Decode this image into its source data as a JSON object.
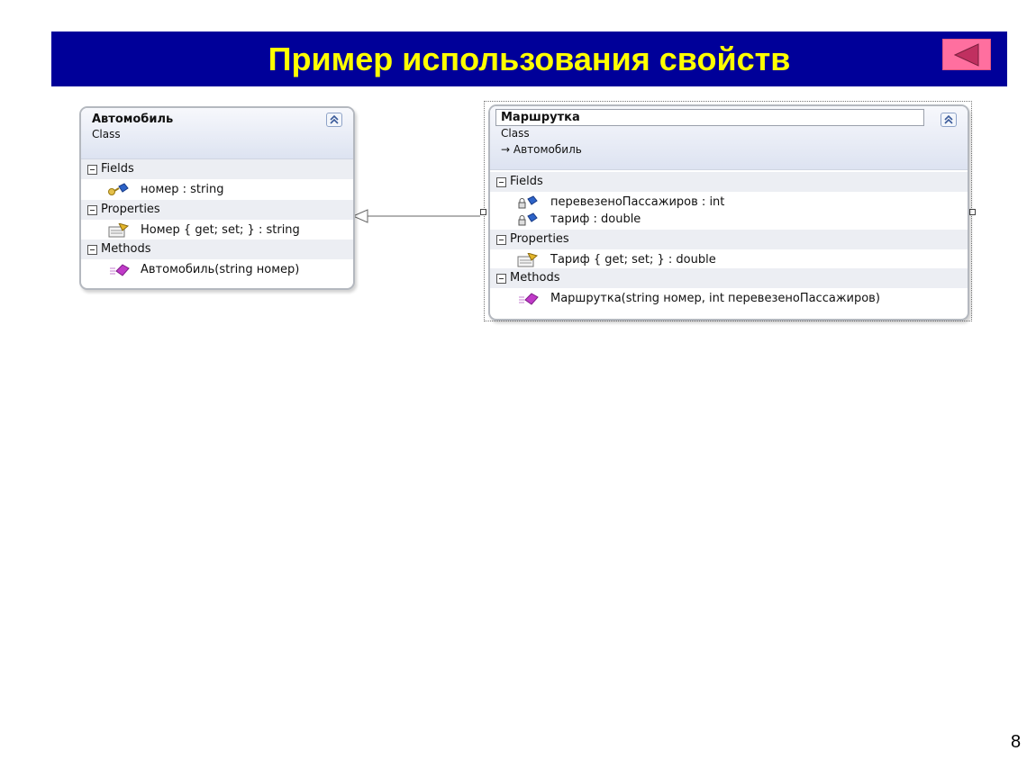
{
  "slide": {
    "title": "Пример использования свойств",
    "page_number": "8",
    "banner_color": "#000099",
    "title_color": "#ffff00",
    "back_button_color": "#ff6f9f"
  },
  "classes": {
    "avtomobil": {
      "name": "Автомобиль",
      "kind": "Class",
      "sections": {
        "fields": "Fields",
        "properties": "Properties",
        "methods": "Methods"
      },
      "fields": [
        "номер : string"
      ],
      "properties": [
        "Номер { get; set; } : string"
      ],
      "methods": [
        "Автомобиль(string номер)"
      ]
    },
    "marshrutka": {
      "name": "Маршрутка",
      "kind": "Class",
      "base": "Автомобиль",
      "sections": {
        "fields": "Fields",
        "properties": "Properties",
        "methods": "Methods"
      },
      "fields": [
        "перевезеноПассажиров : int",
        "тариф : double"
      ],
      "properties": [
        "Тариф { get; set; } : double"
      ],
      "methods": [
        "Маршрутка(string номер, int перевезеноПассажиров)"
      ]
    }
  },
  "relations": [
    {
      "type": "inheritance",
      "from": "Маршрутка",
      "to": "Автомобиль"
    }
  ]
}
